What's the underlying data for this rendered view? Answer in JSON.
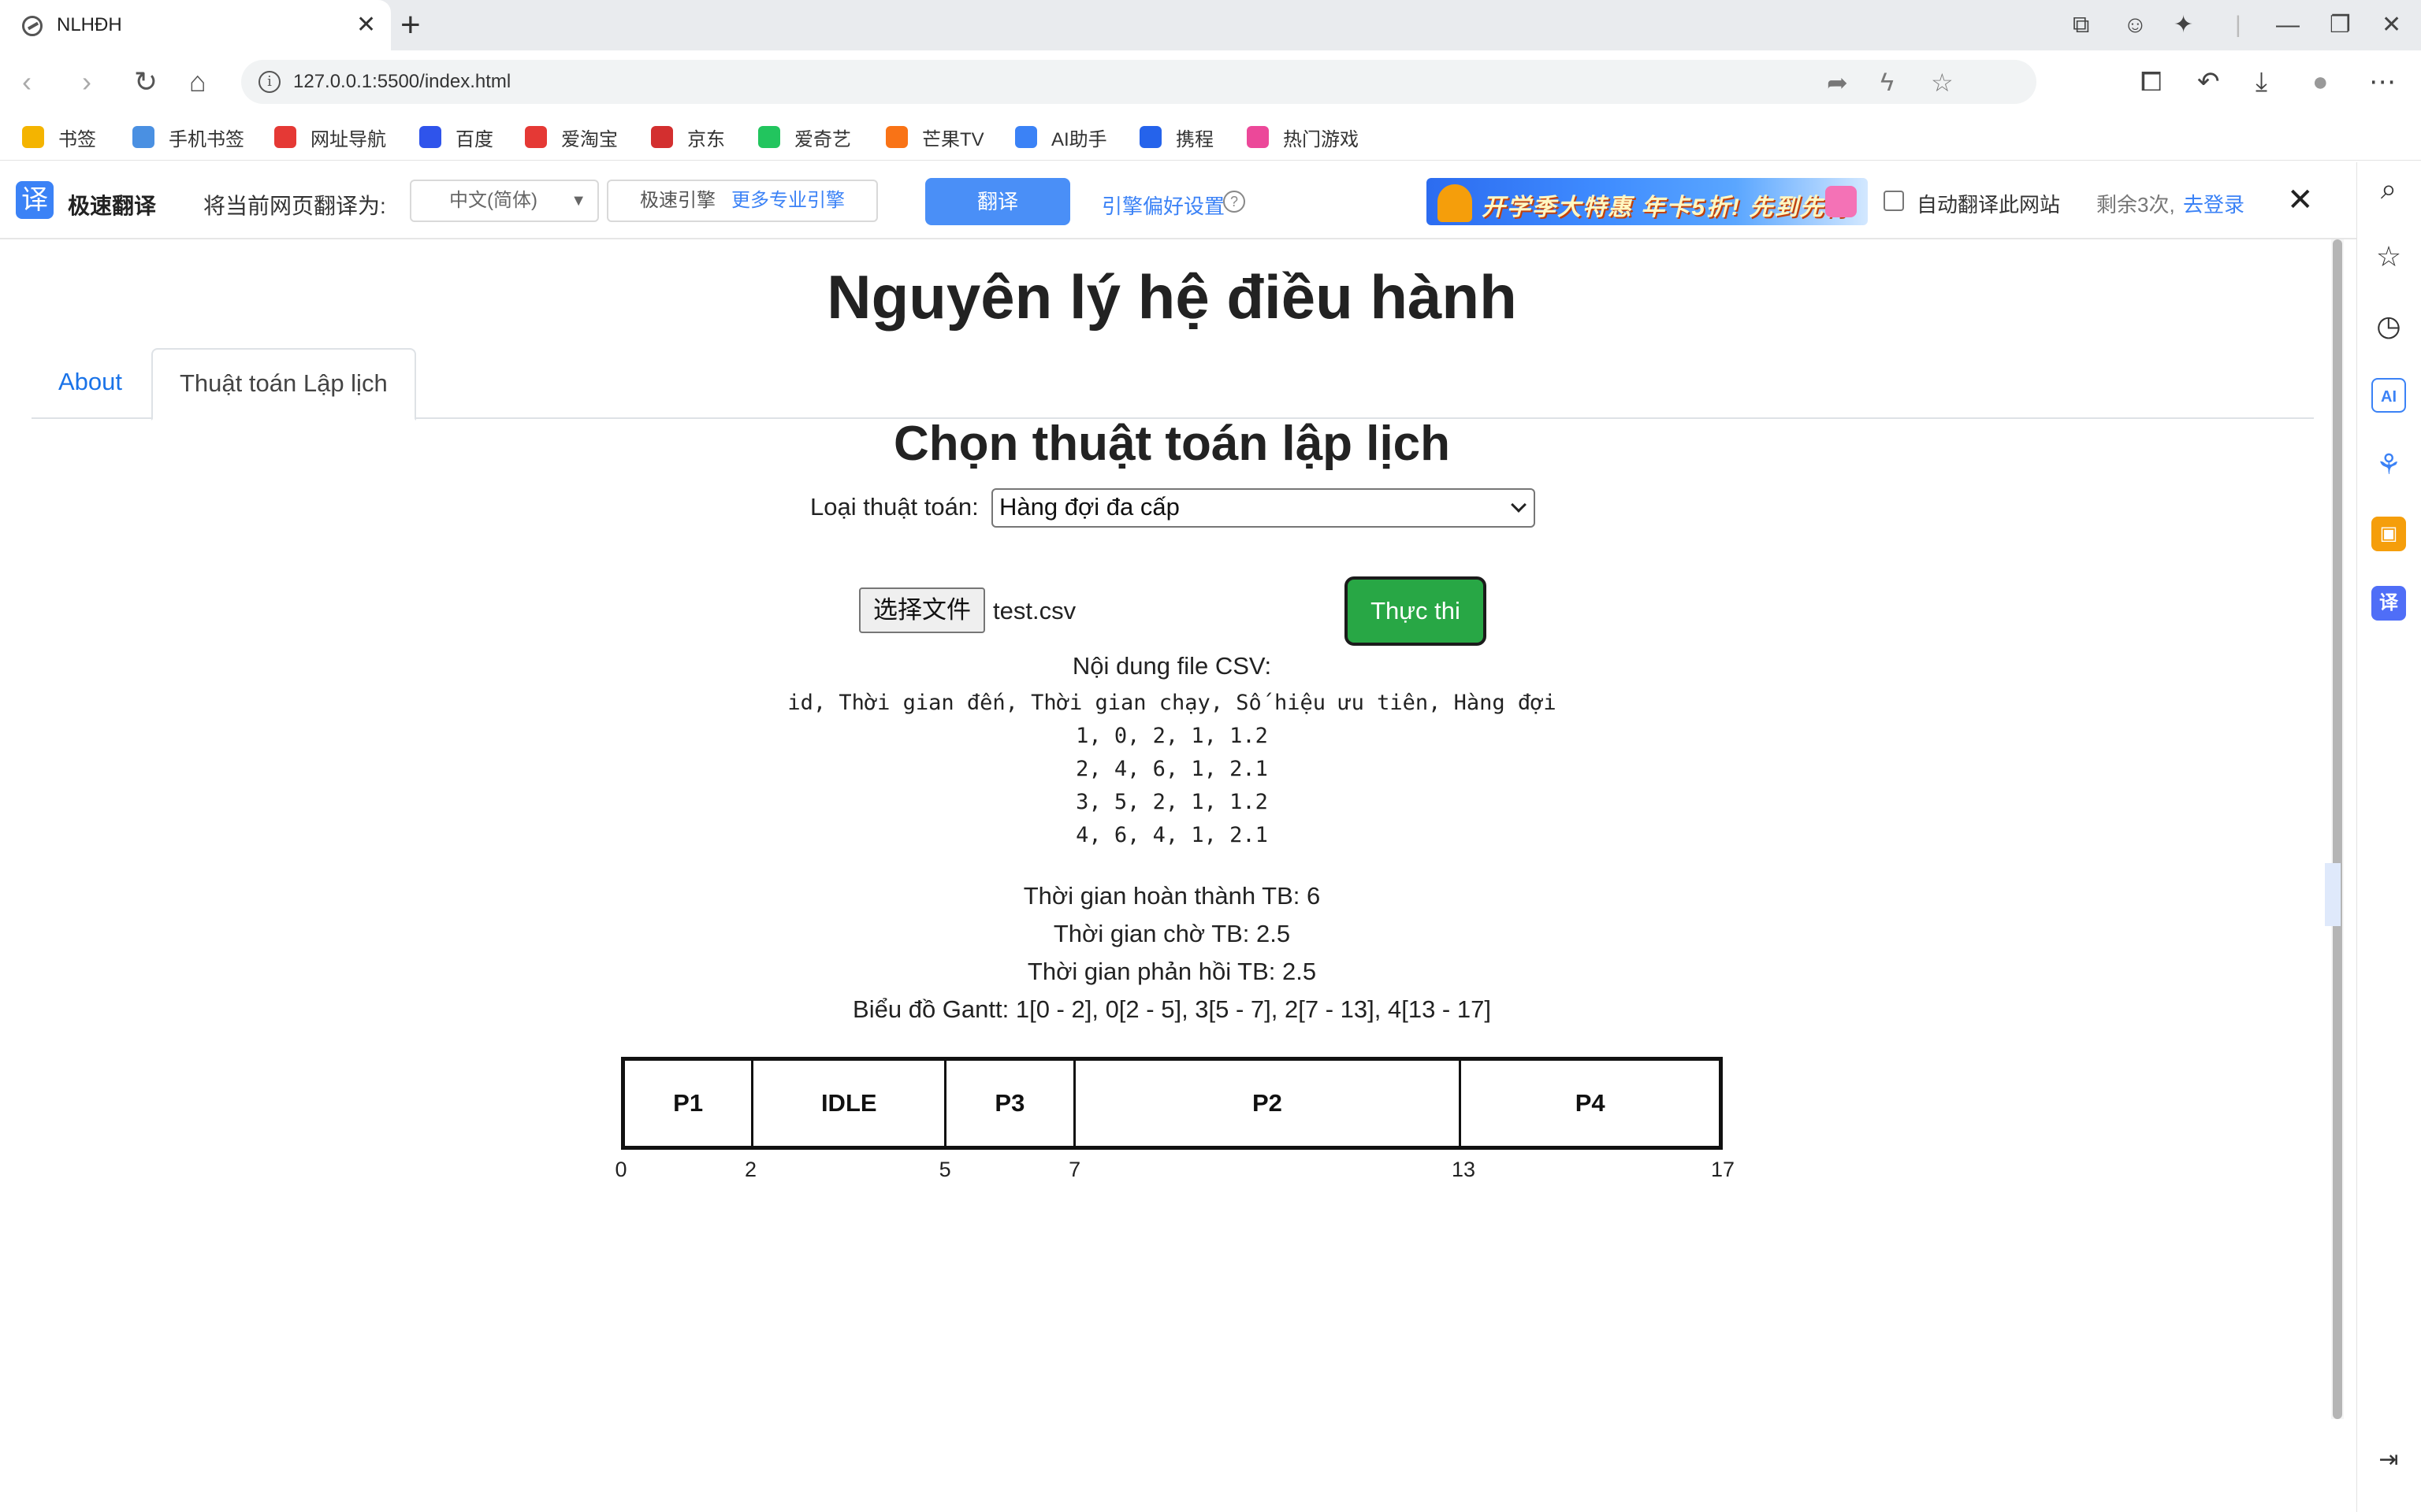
{
  "browser": {
    "tab_title": "NLHĐH",
    "url": "127.0.0.1:5500/index.html",
    "bookmarks": [
      {
        "label": "书签",
        "color": "#f4b400"
      },
      {
        "label": "手机书签",
        "color": "#4a90e2"
      },
      {
        "label": "网址导航",
        "color": "#e53935"
      },
      {
        "label": "百度",
        "color": "#2f54eb"
      },
      {
        "label": "爱淘宝",
        "color": "#e53935"
      },
      {
        "label": "京东",
        "color": "#d32f2f"
      },
      {
        "label": "爱奇艺",
        "color": "#22c55e"
      },
      {
        "label": "芒果TV",
        "color": "#f97316"
      },
      {
        "label": "AI助手",
        "color": "#3b82f6"
      },
      {
        "label": "携程",
        "color": "#2563eb"
      },
      {
        "label": "热门游戏",
        "color": "#ec4899"
      }
    ]
  },
  "translate_bar": {
    "brand": "极速翻译",
    "prompt": "将当前网页翻译为:",
    "language": "中文(简体)",
    "engine": "极速引擎",
    "more_engines": "更多专业引擎",
    "translate_button": "翻译",
    "preferences": "引擎偏好设置",
    "banner_text": "开学季大特惠 年卡5折! 先到先得",
    "auto_translate": "自动翻译此网站",
    "remaining": "剩余3次,",
    "login": "去登录"
  },
  "page": {
    "title": "Nguyên lý hệ điều hành",
    "tabs": [
      {
        "label": "About",
        "active": false
      },
      {
        "label": "Thuật toán Lập lịch",
        "active": true
      }
    ],
    "section_title": "Chọn thuật toán lập lịch",
    "algo_label": "Loại thuật toán:",
    "algo_selected": "Hàng đợi đa cấp",
    "file_button": "选择文件",
    "file_name": "test.csv",
    "run_button": "Thực thi",
    "csv_title": "Nội dung file CSV:",
    "csv_lines": [
      "id, Thời gian đến, Thời gian chạy, Số hiệu ưu tiên, Hàng đợi",
      "1, 0, 2, 1, 1.2",
      "2, 4, 6, 1, 2.1",
      "3, 5, 2, 1, 1.2",
      "4, 6, 4, 1, 2.1"
    ],
    "stats": {
      "avg_completion": "Thời gian hoàn thành TB: 6",
      "avg_wait": "Thời gian chờ TB: 2.5",
      "avg_response": "Thời gian phản hồi TB: 2.5",
      "gantt_text": "Biểu đồ Gantt: 1[0 - 2], 0[2 - 5], 3[5 - 7], 2[7 - 13], 4[13 - 17]"
    },
    "gantt": {
      "segments": [
        {
          "label": "P1",
          "start": 0,
          "end": 2
        },
        {
          "label": "IDLE",
          "start": 2,
          "end": 5
        },
        {
          "label": "P3",
          "start": 5,
          "end": 7
        },
        {
          "label": "P2",
          "start": 7,
          "end": 13
        },
        {
          "label": "P4",
          "start": 13,
          "end": 17
        }
      ],
      "ticks": [
        0,
        2,
        5,
        7,
        13,
        17
      ]
    }
  }
}
